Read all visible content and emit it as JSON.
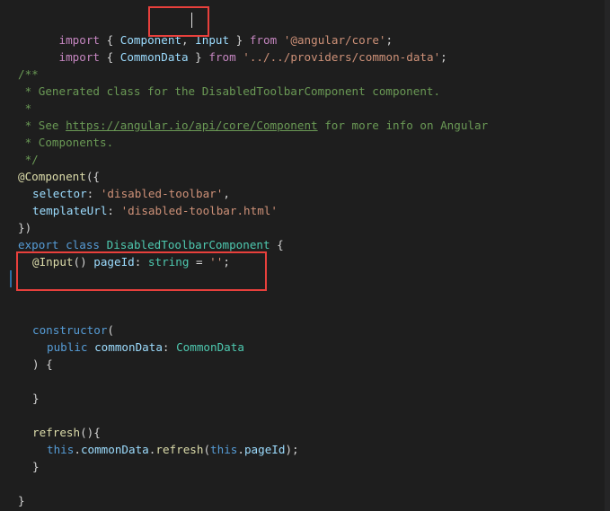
{
  "code": {
    "line1": {
      "kw_import": "import",
      "open": " { ",
      "component": "Component",
      "comma": ", ",
      "input": "Input",
      "close": " } ",
      "kw_from": "from",
      "module": "'@angular/core'",
      "semi": ";"
    },
    "line2": {
      "kw_import": "import",
      "open": " { ",
      "common_data": "CommonData",
      "close": " } ",
      "kw_from": "from",
      "module": "'../../providers/common-data'",
      "semi": ";"
    },
    "comment": {
      "open": "/**",
      "generated": " * Generated class for the DisabledToolbarComponent component.",
      "star": " *",
      "see_prefix": " * See ",
      "see_link": "https://angular.io/api/core/Component",
      "see_suffix": " for more info on Angular",
      "components": " * Components.",
      "close": " */"
    },
    "decorator": {
      "name": "@Component",
      "open": "({",
      "selector_key": "selector",
      "selector_colon": ": ",
      "selector_value": "'disabled-toolbar'",
      "selector_comma": ",",
      "template_key": "templateUrl",
      "template_colon": ": ",
      "template_value": "'disabled-toolbar.html'",
      "close": "})"
    },
    "class_decl": {
      "kw_export": "export",
      "kw_class": "class",
      "class_name": "DisabledToolbarComponent",
      "brace": " {"
    },
    "member": {
      "decorator": "@Input",
      "parens": "() ",
      "name": "pageId",
      "colon": ": ",
      "type": "string",
      "eq": " = ",
      "value": "''",
      "semi": ";"
    },
    "ctor": {
      "name": "constructor",
      "open": "(",
      "kw_public": "public",
      "param": "commonData",
      "colon": ": ",
      "type": "CommonData",
      "close": ") {",
      "end": "}"
    },
    "refresh": {
      "name": "refresh",
      "parens": "(){",
      "kw_this1": "this",
      "dot1": ".",
      "prop": "commonData",
      "dot2": ".",
      "method": "refresh",
      "open": "(",
      "kw_this2": "this",
      "dot3": ".",
      "arg": "pageId",
      "close": ");",
      "end": "}"
    },
    "class_end": "}"
  },
  "colors": {
    "background": "#1e1e1e",
    "keyword": "#569cd6",
    "control_keyword": "#c586c0",
    "string": "#ce9178",
    "comment": "#6a9955",
    "type": "#4ec9b0",
    "variable": "#9cdcfe",
    "function": "#dcdcaa",
    "annotation_box": "#e8403c"
  }
}
